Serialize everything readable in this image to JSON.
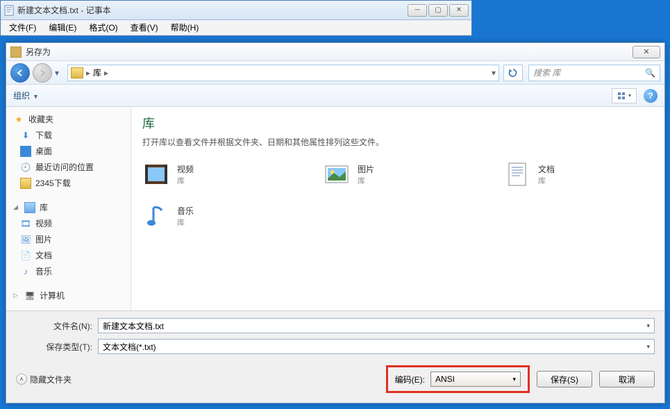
{
  "notepad": {
    "title": "新建文本文档.txt - 记事本",
    "menu": {
      "file": "文件(F)",
      "edit": "编辑(E)",
      "format": "格式(O)",
      "view": "查看(V)",
      "help": "帮助(H)"
    }
  },
  "dialog": {
    "title": "另存为",
    "breadcrumb": {
      "root": "库"
    },
    "search_placeholder": "搜索 库",
    "toolbar": {
      "organize": "组织"
    },
    "sidebar": {
      "favorites": {
        "header": "收藏夹",
        "items": [
          "下载",
          "桌面",
          "最近访问的位置",
          "2345下载"
        ]
      },
      "libraries": {
        "header": "库",
        "items": [
          "视频",
          "图片",
          "文档",
          "音乐"
        ]
      },
      "computer": {
        "header": "计算机"
      }
    },
    "content": {
      "heading": "库",
      "description": "打开库以查看文件并根据文件夹、日期和其他属性排列这些文件。",
      "items": [
        {
          "name": "视频",
          "sub": "库",
          "kind": "video"
        },
        {
          "name": "图片",
          "sub": "库",
          "kind": "picture"
        },
        {
          "name": "文档",
          "sub": "库",
          "kind": "document"
        },
        {
          "name": "音乐",
          "sub": "库",
          "kind": "music"
        }
      ]
    },
    "fields": {
      "filename_label": "文件名(N):",
      "filename_value": "新建文本文档.txt",
      "filetype_label": "保存类型(T):",
      "filetype_value": "文本文档(*.txt)",
      "hide_folders": "隐藏文件夹",
      "encoding_label": "编码(E):",
      "encoding_value": "ANSI",
      "save": "保存(S)",
      "cancel": "取消"
    }
  }
}
